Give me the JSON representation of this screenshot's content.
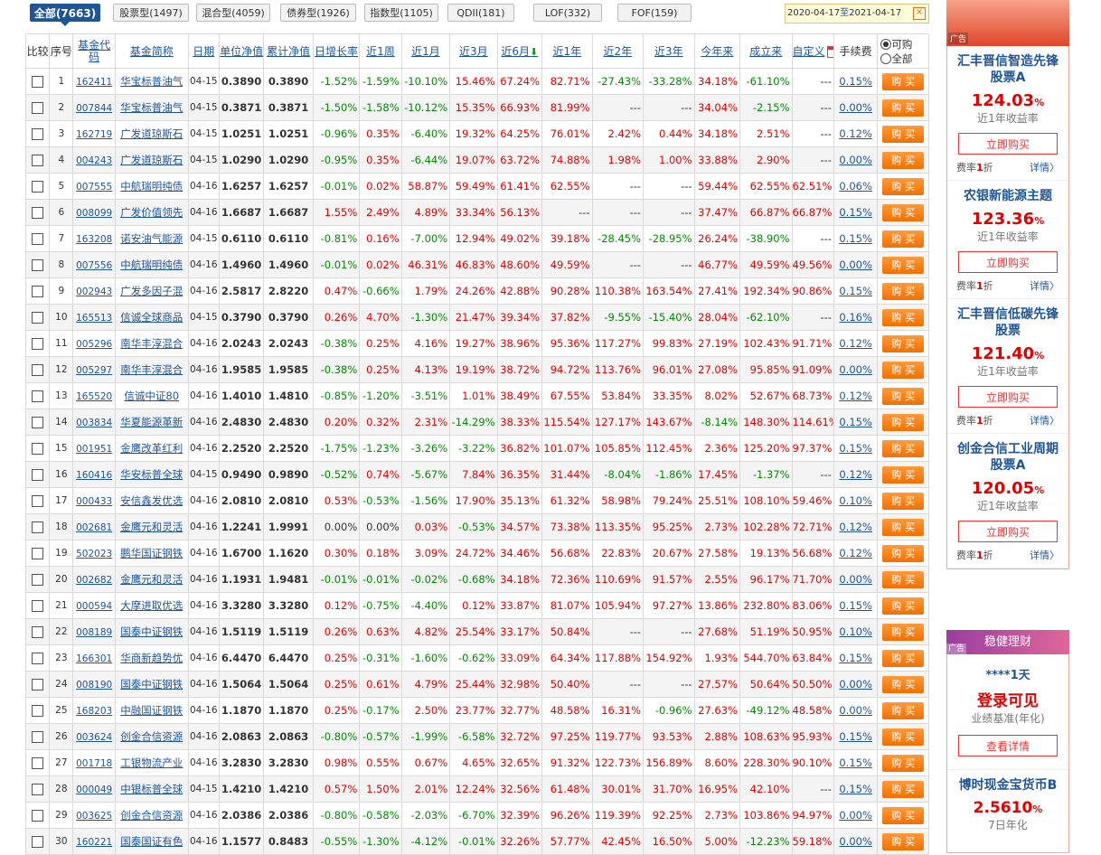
{
  "tabs": [
    {
      "label": "全部(7663)",
      "active": true
    },
    {
      "label": "股票型(1497)"
    },
    {
      "label": "混合型(4059)"
    },
    {
      "label": "债券型(1926)"
    },
    {
      "label": "指数型(1105)"
    },
    {
      "label": "QDII(181)"
    },
    {
      "label": "LOF(332)"
    },
    {
      "label": "FOF(159)"
    }
  ],
  "date_range": {
    "start": "2020-04-17",
    "sep": "至",
    "end": "2021-04-17"
  },
  "headers": {
    "compare": "比较",
    "seq": "序号",
    "code": "基金代码",
    "name": "基金简称",
    "date": "日期",
    "nav": "单位净值",
    "acc": "累计净值",
    "daily": "日增长率",
    "w1": "近1周",
    "m1": "近1月",
    "m3": "近3月",
    "m6": "近6月",
    "y1": "近1年",
    "y2": "近2年",
    "y3": "近3年",
    "ytd": "今年来",
    "since": "成立来",
    "custom": "自定义",
    "fee": "手续费",
    "opt_buyable": "可购",
    "opt_all": "全部"
  },
  "buy_label": "购买",
  "rows": [
    [
      "1",
      "162411",
      "华宝标普油气",
      "04-15",
      "0.3890",
      "0.3890",
      "-1.52%",
      "-1.59%",
      "-10.10%",
      "15.46%",
      "67.24%",
      "82.71%",
      "-27.43%",
      "-33.28%",
      "34.18%",
      "-61.10%",
      "---",
      "0.15%"
    ],
    [
      "2",
      "007844",
      "华宝标普油气",
      "04-15",
      "0.3871",
      "0.3871",
      "-1.50%",
      "-1.58%",
      "-10.12%",
      "15.35%",
      "66.93%",
      "81.99%",
      "---",
      "---",
      "34.04%",
      "-2.15%",
      "---",
      "0.00%"
    ],
    [
      "3",
      "162719",
      "广发道琼斯石",
      "04-15",
      "1.0251",
      "1.0251",
      "-0.96%",
      "0.35%",
      "-6.40%",
      "19.32%",
      "64.25%",
      "76.01%",
      "2.42%",
      "0.44%",
      "34.18%",
      "2.51%",
      "---",
      "0.12%"
    ],
    [
      "4",
      "004243",
      "广发道琼斯石",
      "04-15",
      "1.0290",
      "1.0290",
      "-0.95%",
      "0.35%",
      "-6.44%",
      "19.07%",
      "63.72%",
      "74.88%",
      "1.98%",
      "1.00%",
      "33.88%",
      "2.90%",
      "---",
      "0.00%"
    ],
    [
      "5",
      "007555",
      "中航瑞明纯债",
      "04-16",
      "1.6257",
      "1.6257",
      "-0.01%",
      "0.02%",
      "58.87%",
      "59.49%",
      "61.41%",
      "62.55%",
      "---",
      "---",
      "59.44%",
      "62.55%",
      "62.51%",
      "0.06%"
    ],
    [
      "6",
      "008099",
      "广发价值领先",
      "04-16",
      "1.6687",
      "1.6687",
      "1.55%",
      "2.49%",
      "4.89%",
      "33.34%",
      "56.13%",
      "---",
      "---",
      "---",
      "37.47%",
      "66.87%",
      "66.87%",
      "0.15%"
    ],
    [
      "7",
      "163208",
      "诺安油气能源",
      "04-15",
      "0.6110",
      "0.6110",
      "-0.81%",
      "0.16%",
      "-7.00%",
      "12.94%",
      "49.02%",
      "39.18%",
      "-28.45%",
      "-28.95%",
      "26.24%",
      "-38.90%",
      "---",
      "0.15%"
    ],
    [
      "8",
      "007556",
      "中航瑞明纯债",
      "04-16",
      "1.4960",
      "1.4960",
      "-0.01%",
      "0.02%",
      "46.31%",
      "46.83%",
      "48.60%",
      "49.59%",
      "---",
      "---",
      "46.77%",
      "49.59%",
      "49.56%",
      "0.00%"
    ],
    [
      "9",
      "002943",
      "广发多因子混",
      "04-16",
      "2.5817",
      "2.8220",
      "0.47%",
      "-0.66%",
      "1.79%",
      "24.26%",
      "42.88%",
      "90.28%",
      "110.38%",
      "163.54%",
      "27.41%",
      "192.34%",
      "90.86%",
      "0.15%"
    ],
    [
      "10",
      "165513",
      "信诚全球商品",
      "04-15",
      "0.3790",
      "0.3790",
      "0.26%",
      "4.70%",
      "-1.30%",
      "21.47%",
      "39.34%",
      "37.82%",
      "-9.55%",
      "-15.40%",
      "28.04%",
      "-62.10%",
      "---",
      "0.16%"
    ],
    [
      "11",
      "005296",
      "南华丰淳混合",
      "04-16",
      "2.0243",
      "2.0243",
      "-0.38%",
      "0.25%",
      "4.16%",
      "19.27%",
      "38.96%",
      "95.36%",
      "117.27%",
      "99.83%",
      "27.19%",
      "102.43%",
      "91.71%",
      "0.12%"
    ],
    [
      "12",
      "005297",
      "南华丰淳混合",
      "04-16",
      "1.9585",
      "1.9585",
      "-0.38%",
      "0.25%",
      "4.13%",
      "19.19%",
      "38.72%",
      "94.72%",
      "113.76%",
      "96.01%",
      "27.08%",
      "95.85%",
      "91.09%",
      "0.00%"
    ],
    [
      "13",
      "165520",
      "信诚中证80",
      "04-16",
      "1.4010",
      "1.4810",
      "-0.85%",
      "-1.20%",
      "-3.51%",
      "1.01%",
      "38.49%",
      "67.55%",
      "53.84%",
      "33.35%",
      "8.02%",
      "52.67%",
      "68.73%",
      "0.12%"
    ],
    [
      "14",
      "003834",
      "华夏能源革新",
      "04-16",
      "2.4830",
      "2.4830",
      "0.20%",
      "0.32%",
      "2.31%",
      "-14.29%",
      "38.33%",
      "115.54%",
      "127.17%",
      "143.67%",
      "-8.14%",
      "148.30%",
      "114.61%",
      "0.15%"
    ],
    [
      "15",
      "001951",
      "金鹰改革红利",
      "04-16",
      "2.2520",
      "2.2520",
      "-1.75%",
      "-1.23%",
      "-3.26%",
      "-3.22%",
      "36.82%",
      "101.07%",
      "105.85%",
      "112.45%",
      "2.36%",
      "125.20%",
      "97.37%",
      "0.15%"
    ],
    [
      "16",
      "160416",
      "华安标普全球",
      "04-15",
      "0.9490",
      "0.9890",
      "-0.52%",
      "0.74%",
      "-5.67%",
      "7.84%",
      "36.35%",
      "31.44%",
      "-8.04%",
      "-1.86%",
      "17.45%",
      "-1.37%",
      "---",
      "0.12%"
    ],
    [
      "17",
      "000433",
      "安信鑫发优选",
      "04-16",
      "2.0810",
      "2.0810",
      "0.53%",
      "-0.53%",
      "-1.56%",
      "17.90%",
      "35.13%",
      "61.32%",
      "58.98%",
      "79.24%",
      "25.51%",
      "108.10%",
      "59.46%",
      "0.10%"
    ],
    [
      "18",
      "002681",
      "金鹰元和灵活",
      "04-16",
      "1.2241",
      "1.9991",
      "0.00%",
      "0.00%",
      "0.03%",
      "-0.53%",
      "34.57%",
      "73.38%",
      "113.35%",
      "95.25%",
      "2.73%",
      "102.28%",
      "72.71%",
      "0.12%"
    ],
    [
      "19",
      "502023",
      "鹏华国证钢铁",
      "04-16",
      "1.6700",
      "1.1620",
      "0.30%",
      "0.18%",
      "3.09%",
      "24.72%",
      "34.46%",
      "56.68%",
      "22.83%",
      "20.67%",
      "27.58%",
      "19.13%",
      "56.68%",
      "0.12%"
    ],
    [
      "20",
      "002682",
      "金鹰元和灵活",
      "04-16",
      "1.1931",
      "1.9481",
      "-0.01%",
      "-0.01%",
      "-0.02%",
      "-0.68%",
      "34.18%",
      "72.36%",
      "110.69%",
      "91.57%",
      "2.55%",
      "96.17%",
      "71.70%",
      "0.00%"
    ],
    [
      "21",
      "000594",
      "大摩进取优选",
      "04-16",
      "3.3280",
      "3.3280",
      "0.12%",
      "-0.75%",
      "-4.40%",
      "0.12%",
      "33.87%",
      "81.07%",
      "105.94%",
      "97.27%",
      "13.86%",
      "232.80%",
      "83.06%",
      "0.15%"
    ],
    [
      "22",
      "008189",
      "国泰中证钢铁",
      "04-16",
      "1.5119",
      "1.5119",
      "0.26%",
      "0.63%",
      "4.82%",
      "25.54%",
      "33.17%",
      "50.84%",
      "---",
      "---",
      "27.68%",
      "51.19%",
      "50.95%",
      "0.10%"
    ],
    [
      "23",
      "166301",
      "华商新趋势优",
      "04-16",
      "6.4470",
      "6.4470",
      "0.25%",
      "-0.31%",
      "-1.60%",
      "-0.62%",
      "33.09%",
      "64.34%",
      "117.88%",
      "154.92%",
      "1.93%",
      "544.70%",
      "63.84%",
      "0.15%"
    ],
    [
      "24",
      "008190",
      "国泰中证钢铁",
      "04-16",
      "1.5064",
      "1.5064",
      "0.25%",
      "0.61%",
      "4.79%",
      "25.44%",
      "32.98%",
      "50.40%",
      "---",
      "---",
      "27.57%",
      "50.64%",
      "50.50%",
      "0.00%"
    ],
    [
      "25",
      "168203",
      "中融国证钢铁",
      "04-16",
      "1.1870",
      "1.1870",
      "0.25%",
      "-0.17%",
      "2.50%",
      "23.77%",
      "32.77%",
      "48.58%",
      "16.31%",
      "-0.96%",
      "27.63%",
      "-49.12%",
      "48.58%",
      "0.00%"
    ],
    [
      "26",
      "003624",
      "创金合信资源",
      "04-16",
      "2.0863",
      "2.0863",
      "-0.80%",
      "-0.57%",
      "-1.99%",
      "-6.58%",
      "32.72%",
      "97.25%",
      "119.77%",
      "93.53%",
      "2.88%",
      "108.63%",
      "95.93%",
      "0.15%"
    ],
    [
      "27",
      "001718",
      "工银物流产业",
      "04-16",
      "3.2830",
      "3.2830",
      "0.98%",
      "0.55%",
      "0.67%",
      "4.65%",
      "32.65%",
      "91.32%",
      "122.73%",
      "156.89%",
      "8.60%",
      "228.30%",
      "90.10%",
      "0.15%"
    ],
    [
      "28",
      "000049",
      "中银标普全球",
      "04-15",
      "1.4210",
      "1.4210",
      "0.57%",
      "1.50%",
      "2.01%",
      "12.24%",
      "32.56%",
      "61.48%",
      "30.01%",
      "31.70%",
      "16.95%",
      "42.10%",
      "---",
      "0.15%"
    ],
    [
      "29",
      "003625",
      "创金合信资源",
      "04-16",
      "2.0386",
      "2.0386",
      "-0.80%",
      "-0.58%",
      "-2.03%",
      "-6.70%",
      "32.39%",
      "96.26%",
      "119.39%",
      "92.25%",
      "2.73%",
      "103.86%",
      "94.97%",
      "0.00%"
    ],
    [
      "30",
      "160221",
      "国泰国证有色",
      "04-16",
      "1.1577",
      "0.8483",
      "-0.55%",
      "-1.30%",
      "-4.12%",
      "-0.01%",
      "32.26%",
      "57.77%",
      "42.45%",
      "16.50%",
      "5.00%",
      "-12.23%",
      "59.18%",
      "0.00%"
    ]
  ],
  "sidebar": {
    "ad_tag": "广告",
    "cards": [
      {
        "title": "汇丰晋信智造先锋股票A",
        "value": "124.03",
        "unit": "%",
        "label": "近1年收益率",
        "btn": "立即购买",
        "fee_pre": "费率",
        "fee_num": "1",
        "fee_post": "折",
        "detail": "详情〉"
      },
      {
        "title": "农银新能源主题",
        "value": "123.36",
        "unit": "%",
        "label": "近1年收益率",
        "btn": "立即购买",
        "fee_pre": "费率",
        "fee_num": "1",
        "fee_post": "折",
        "detail": "详情〉"
      },
      {
        "title": "汇丰晋信低碳先锋股票",
        "value": "121.40",
        "unit": "%",
        "label": "近1年收益率",
        "btn": "立即购买",
        "fee_pre": "费率",
        "fee_num": "1",
        "fee_post": "折",
        "detail": "详情〉"
      },
      {
        "title": "创金合信工业周期股票A",
        "value": "120.05",
        "unit": "%",
        "label": "近1年收益率",
        "btn": "立即购买",
        "fee_pre": "费率",
        "fee_num": "1",
        "fee_post": "折",
        "detail": "详情〉"
      }
    ],
    "wealth_banner": "稳健理财",
    "wealth": {
      "days": "****1天",
      "login": "登录可见",
      "label": "业绩基准(年化)",
      "btn": "查看详情"
    },
    "money_card": {
      "title": "博时现金宝货币B",
      "value": "2.5610",
      "unit": "%",
      "label": "7日年化"
    }
  }
}
